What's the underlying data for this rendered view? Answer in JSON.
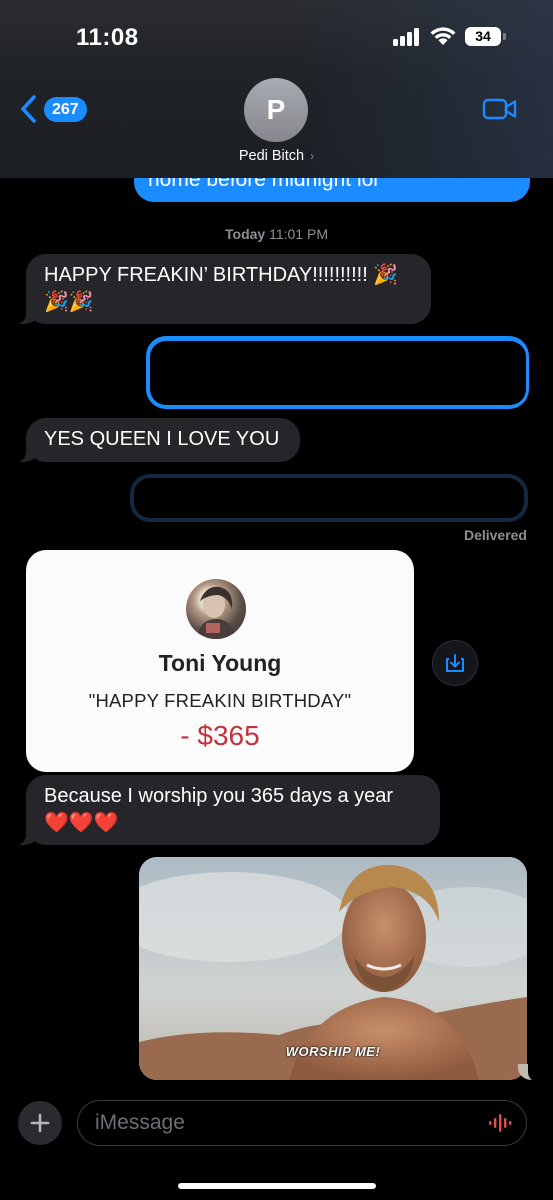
{
  "status_bar": {
    "time": "11:08",
    "battery": "34"
  },
  "nav": {
    "back_count": "267",
    "contact_initial": "P",
    "contact_name": "Pedi Bitch",
    "contact_chevron": "›"
  },
  "thread": {
    "partial_sent_text": "home before midnight lol",
    "timestamp_day": "Today",
    "timestamp_time": "11:01 PM",
    "msg_birthday": "HAPPY FREAKIN’ BIRTHDAY!!!!!!!!!! 🎉",
    "msg_birthday_line2": "🎉🎉",
    "msg_queen": "YES QUEEN I LOVE YOU",
    "delivered_label": "Delivered",
    "payment": {
      "name": "Toni Young",
      "note": "\"HAPPY FREAKIN BIRTHDAY\"",
      "amount": "- $365",
      "amount_color": "#c1343d"
    },
    "msg_worship": "Because I worship you 365 days a year",
    "msg_worship_line2": "❤️❤️❤️",
    "photo_caption": "WORSHIP ME!"
  },
  "composer": {
    "placeholder": "iMessage",
    "plus": "+"
  },
  "colors": {
    "accent_blue": "#1b8cff",
    "incoming_bubble": "#26262a",
    "background": "#000000"
  },
  "icons": [
    "chevron-left-icon",
    "video-camera-icon",
    "download-icon",
    "plus-icon",
    "audio-waveform-icon",
    "signal-icon",
    "wifi-icon",
    "battery-icon"
  ]
}
